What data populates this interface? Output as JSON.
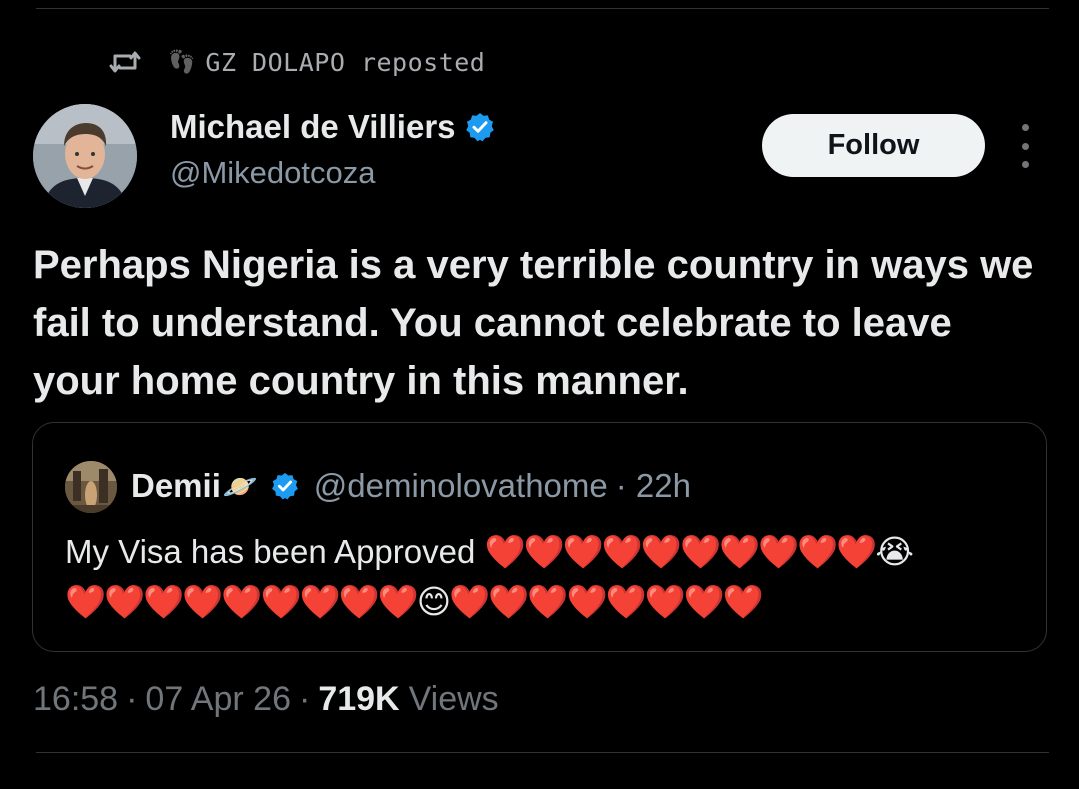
{
  "repost": {
    "user": "GZ DOLAPO",
    "text": "reposted",
    "user_emoji": "👣"
  },
  "author": {
    "name": "Michael de Villiers",
    "handle": "@Mikedotcoza",
    "verified": true
  },
  "follow_label": "Follow",
  "tweet": {
    "text": "Perhaps Nigeria is a very terrible country in ways we fail to understand. You cannot celebrate to leave your home country in this manner."
  },
  "quote": {
    "name": "Demii",
    "name_emoji": "🪐",
    "handle": "@deminolovathome",
    "time": "· 22h",
    "text": "My Visa has been Approved",
    "emojis_line1": "❤️❤️❤️❤️❤️❤️❤️❤️❤️❤️😭",
    "emojis_line2": "❤️❤️❤️❤️❤️❤️❤️❤️❤️😊❤️❤️❤️❤️❤️❤️❤️❤️"
  },
  "meta": {
    "time": "16:58",
    "date": "07 Apr 26",
    "views": "719K",
    "views_label": "Views",
    "separator": "·"
  },
  "colors": {
    "background": "#000000",
    "text": "#e7e9ea",
    "secondary": "#71767b",
    "verified": "#1d9bf0",
    "button_bg": "#eff3f4"
  }
}
